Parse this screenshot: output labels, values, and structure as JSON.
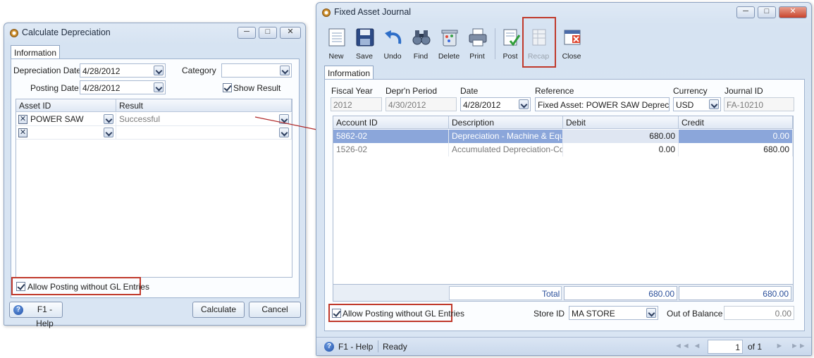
{
  "calc": {
    "title": "Calculate Depreciation",
    "tab": "Information",
    "depreciation_date_label": "Depreciation Date",
    "depreciation_date": "4/28/2012",
    "posting_date_label": "Posting Date",
    "posting_date": "4/28/2012",
    "category_label": "Category",
    "category_value": "",
    "show_result_label": "Show Result",
    "grid": {
      "headers": [
        "Asset ID",
        "Result"
      ],
      "rows": [
        {
          "asset_id": "POWER SAW",
          "result": "Successful"
        },
        {
          "asset_id": "",
          "result": ""
        }
      ]
    },
    "allow_posting_label": "Allow Posting without GL Entries",
    "help_label": "F1 - Help",
    "calculate_label": "Calculate",
    "cancel_label": "Cancel"
  },
  "journal": {
    "title": "Fixed Asset Journal",
    "toolbar": {
      "new": "New",
      "save": "Save",
      "undo": "Undo",
      "find": "Find",
      "delete": "Delete",
      "print": "Print",
      "post": "Post",
      "recap": "Recap",
      "close": "Close"
    },
    "tab": "Information",
    "fiscal_year_label": "Fiscal Year",
    "fiscal_year": "2012",
    "depr_period_label": "Depr'n Period",
    "depr_period": "4/30/2012",
    "date_label": "Date",
    "date": "4/28/2012",
    "reference_label": "Reference",
    "reference": "Fixed Asset: POWER SAW Depreciation",
    "currency_label": "Currency",
    "currency": "USD",
    "journal_id_label": "Journal ID",
    "journal_id": "FA-10210",
    "grid": {
      "headers": [
        "Account ID",
        "Description",
        "Debit",
        "Credit"
      ],
      "rows": [
        {
          "account_id": "5862-02",
          "description": "Depreciation - Machine & Equi...",
          "debit": "680.00",
          "credit": "0.00"
        },
        {
          "account_id": "1526-02",
          "description": "Accumulated Depreciation-Cor...",
          "debit": "0.00",
          "credit": "680.00"
        }
      ],
      "total_label": "Total",
      "total_debit": "680.00",
      "total_credit": "680.00"
    },
    "allow_posting_label": "Allow Posting without GL Entries",
    "store_id_label": "Store ID",
    "store_id": "MA STORE",
    "out_of_balance_label": "Out of Balance",
    "out_of_balance": "0.00",
    "help_label": "F1 - Help",
    "status": "Ready",
    "page_current": "1",
    "page_of": "of 1"
  },
  "colors": {
    "selected_row": "#8ba6da",
    "highlight_border": "#c0392b",
    "window_bg": "#d9e5f3"
  }
}
